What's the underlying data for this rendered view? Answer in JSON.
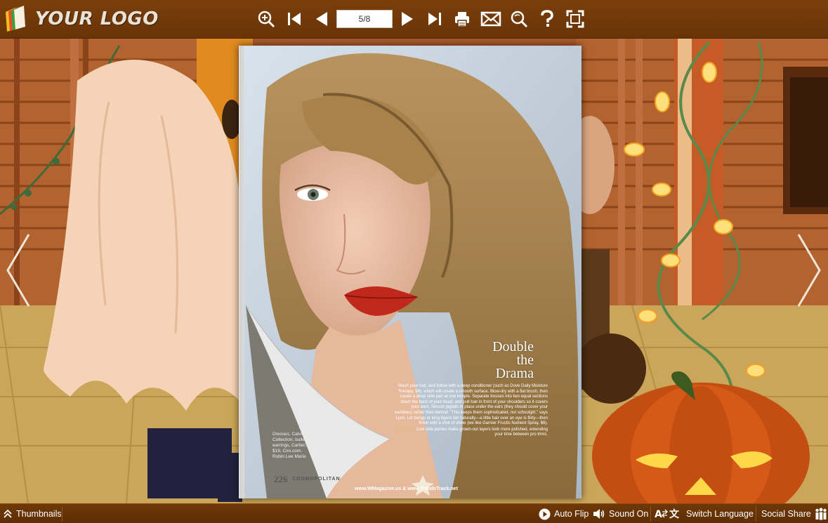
{
  "toolbar": {
    "logo_text": "YOUR LOGO",
    "page_indicator": "5/8",
    "buttons": [
      "zoom-in",
      "first-page",
      "previous-page",
      "next-page",
      "last-page",
      "print",
      "email",
      "search",
      "help",
      "fullscreen"
    ]
  },
  "book": {
    "headline_line1": "Double",
    "headline_line2": "the",
    "headline_line3": "Drama",
    "body_text": "Wash your hair, and follow with a deep conditioner (such as Dove Daily Moisture Therapy, $4), which will create a smooth surface. Blow-dry with a flat brush, then create a deep side part at one temple. Separate tresses into two equal sections down the back of your head, and pull hair in front of your shoulders so it covers your ears. Secure pigtails in place under the ears (they should cover your earlobes) rather than behind. \"This keeps them sophisticated, not schoolgirl,\" says Lyon. Let bangs or long layers fall naturally—a little hair over an eye is flirty—then finish with a shot of shine (we like Garnier Fructis Nutrient Spray, $6).",
    "bonus_label": "BONUS:",
    "bonus_text": "Low side ponies make grown-out layers look more polished, extending your time between pro trims.",
    "credit_lines": [
      "Dresses, Calvin",
      "Collection; bullet",
      "earrings, Cartier;",
      "$19, Ciro.com.",
      "Robin Lee Marie"
    ],
    "page_number": "226",
    "magazine": "COSMOPOLITAN",
    "footer_url": "www.WMagazine.us & www.TrendsTrack.net"
  },
  "bottom": {
    "thumbnails": "Thumbnails",
    "auto_flip": "Auto Flip",
    "sound_on": "Sound On",
    "switch_language": "Switch Language",
    "social_share": "Social Share"
  },
  "colors": {
    "toolbar_bg": "#6f3807",
    "accent_bg": "#b86a35",
    "lip": "#c0281c"
  }
}
